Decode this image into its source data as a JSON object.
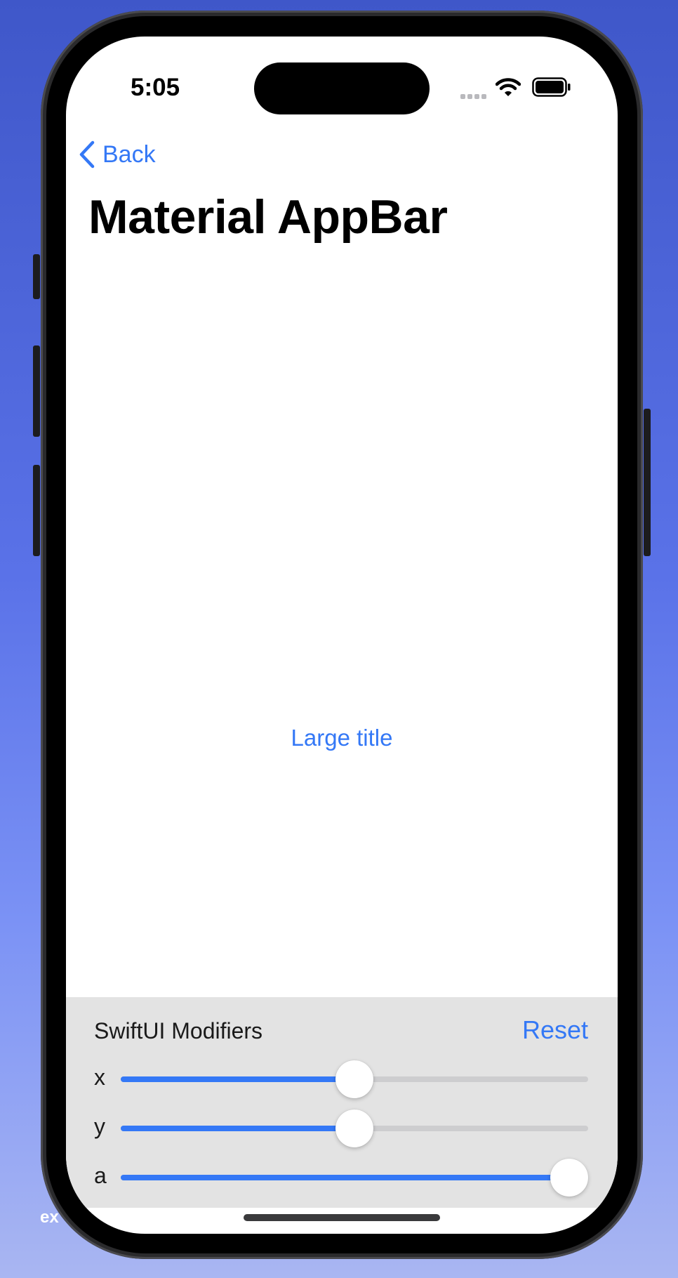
{
  "status_bar": {
    "time": "5:05",
    "icons": [
      "signal-dots-icon",
      "wifi-icon",
      "battery-icon"
    ]
  },
  "nav": {
    "back_label": "Back",
    "back_icon": "chevron-left-icon",
    "title": "Material AppBar"
  },
  "content": {
    "link_label": "Large title"
  },
  "modifiers_panel": {
    "title": "SwiftUI Modifiers",
    "reset_label": "Reset",
    "sliders": [
      {
        "label": "x",
        "value": 0.5
      },
      {
        "label": "y",
        "value": 0.5
      },
      {
        "label": "a",
        "value": 1.0
      }
    ]
  },
  "background_text": "ex",
  "colors": {
    "accent": "#3478f6",
    "panel_background": "#e3e3e3",
    "track": "#cdcdcf"
  }
}
